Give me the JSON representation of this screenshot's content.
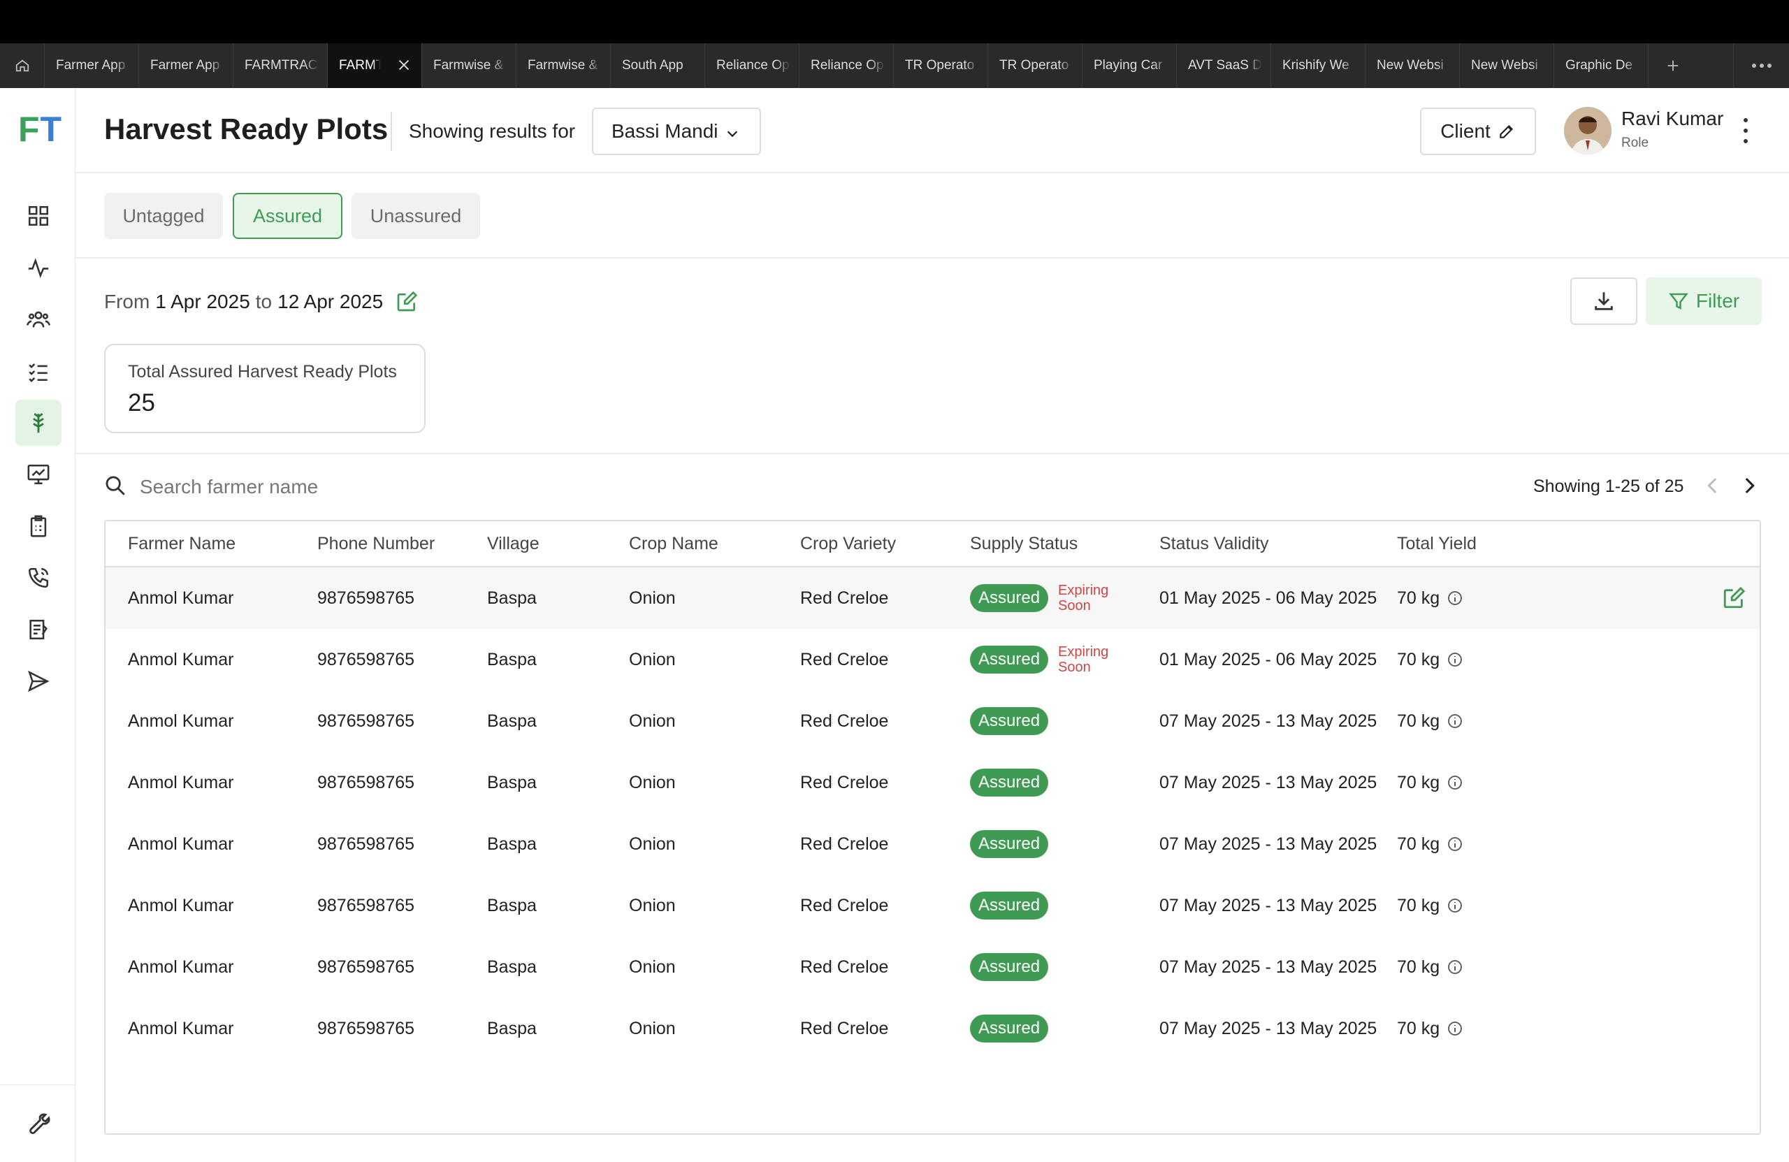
{
  "browser": {
    "tabs": [
      "Farmer App",
      "Farmer App",
      "FARMTRAC",
      "FARMTRAC",
      "Farmwise &",
      "Farmwise &",
      "South App",
      "Reliance Op",
      "Reliance Op",
      "TR Operato",
      "TR Operato",
      "Playing Car",
      "AVT SaaS D",
      "Krishify We",
      "New Websi",
      "New Websi",
      "Graphic De"
    ],
    "active_tab_index": 3
  },
  "app": {
    "logo_f": "F",
    "logo_t": "T"
  },
  "header": {
    "title": "Harvest Ready Plots",
    "showing_label": "Showing results for",
    "location": "Bassi Mandi",
    "client_label": "Client",
    "user_name": "Ravi Kumar",
    "user_role": "Role"
  },
  "status_tabs": [
    {
      "label": "Untagged",
      "active": false
    },
    {
      "label": "Assured",
      "active": true
    },
    {
      "label": "Unassured",
      "active": false
    }
  ],
  "date_range": {
    "from_word": "From",
    "from": "1 Apr 2025",
    "to_word": "to",
    "to": "12 Apr 2025"
  },
  "filter_label": "Filter",
  "stat": {
    "label": "Total Assured Harvest Ready Plots",
    "value": "25"
  },
  "search": {
    "placeholder": "Search farmer name",
    "value": ""
  },
  "pagination": {
    "text": "Showing 1-25 of 25"
  },
  "table": {
    "headers": [
      "Farmer Name",
      "Phone Number",
      "Village",
      "Crop Name",
      "Crop Variety",
      "Supply Status",
      "Status Validity",
      "Total Yield"
    ],
    "rows": [
      {
        "farmer": "Anmol Kumar",
        "phone": "9876598765",
        "village": "Baspa",
        "crop": "Onion",
        "variety": "Red Creloe",
        "status": "Assured",
        "flag": "Expiring Soon",
        "validity": "01 May 2025 - 06 May 2025",
        "yield": "70 kg"
      },
      {
        "farmer": "Anmol Kumar",
        "phone": "9876598765",
        "village": "Baspa",
        "crop": "Onion",
        "variety": "Red Creloe",
        "status": "Assured",
        "flag": "Expiring Soon",
        "validity": "01 May 2025 - 06 May 2025",
        "yield": "70 kg"
      },
      {
        "farmer": "Anmol Kumar",
        "phone": "9876598765",
        "village": "Baspa",
        "crop": "Onion",
        "variety": "Red Creloe",
        "status": "Assured",
        "flag": "",
        "validity": "07 May 2025 - 13 May 2025",
        "yield": "70 kg"
      },
      {
        "farmer": "Anmol Kumar",
        "phone": "9876598765",
        "village": "Baspa",
        "crop": "Onion",
        "variety": "Red Creloe",
        "status": "Assured",
        "flag": "",
        "validity": "07 May 2025 - 13 May 2025",
        "yield": "70 kg"
      },
      {
        "farmer": "Anmol Kumar",
        "phone": "9876598765",
        "village": "Baspa",
        "crop": "Onion",
        "variety": "Red Creloe",
        "status": "Assured",
        "flag": "",
        "validity": "07 May 2025 - 13 May 2025",
        "yield": "70 kg"
      },
      {
        "farmer": "Anmol Kumar",
        "phone": "9876598765",
        "village": "Baspa",
        "crop": "Onion",
        "variety": "Red Creloe",
        "status": "Assured",
        "flag": "",
        "validity": "07 May 2025 - 13 May 2025",
        "yield": "70 kg"
      },
      {
        "farmer": "Anmol Kumar",
        "phone": "9876598765",
        "village": "Baspa",
        "crop": "Onion",
        "variety": "Red Creloe",
        "status": "Assured",
        "flag": "",
        "validity": "07 May 2025 - 13 May 2025",
        "yield": "70 kg"
      },
      {
        "farmer": "Anmol Kumar",
        "phone": "9876598765",
        "village": "Baspa",
        "crop": "Onion",
        "variety": "Red Creloe",
        "status": "Assured",
        "flag": "",
        "validity": "07 May 2025 - 13 May 2025",
        "yield": "70 kg"
      }
    ]
  },
  "colors": {
    "accent_green": "#3f9b53",
    "expiring_red": "#d04545",
    "logo_blue": "#3a7fd5"
  },
  "icons": {
    "sidebar": [
      "dashboard-icon",
      "activity-icon",
      "farmers-icon",
      "checklist-icon",
      "harvest-icon",
      "monitor-icon",
      "clipboard-icon",
      "phone-icon",
      "report-icon",
      "send-icon"
    ],
    "bottom": "wrench-icon"
  }
}
